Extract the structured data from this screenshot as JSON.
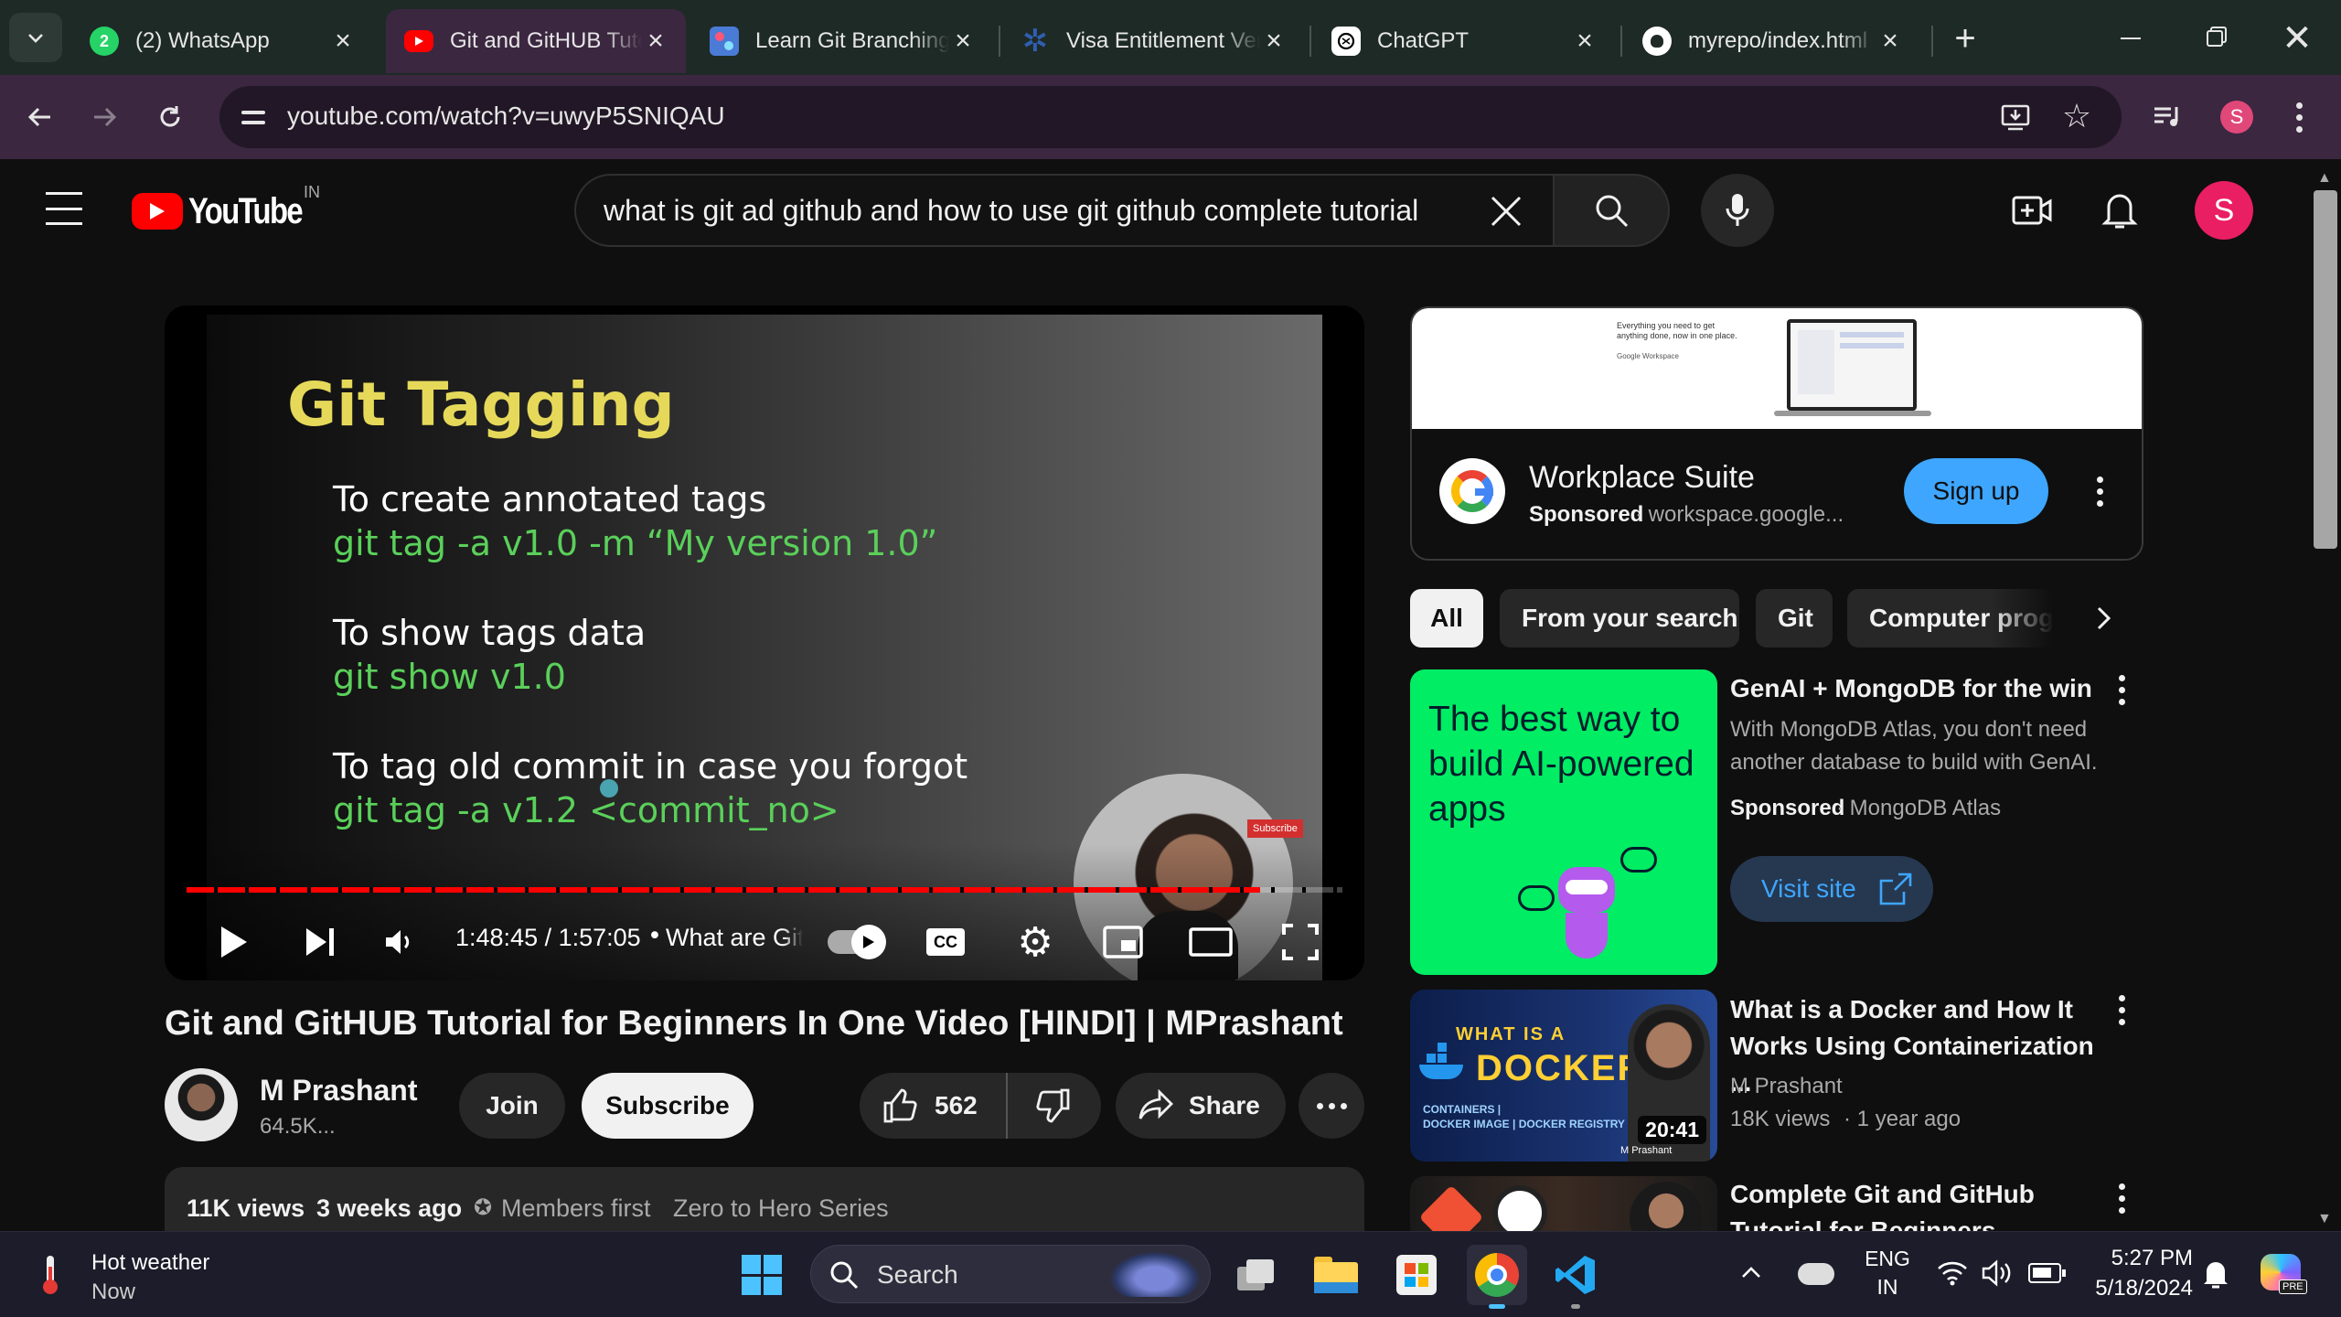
{
  "browser": {
    "tabs": [
      {
        "label": "(2) WhatsApp",
        "badge": "2"
      },
      {
        "label": "Git and GitHUB Tutorial for Beginners",
        "active": true
      },
      {
        "label": "Learn Git Branching"
      },
      {
        "label": "Visa Entitlement Verification"
      },
      {
        "label": "ChatGPT"
      },
      {
        "label": "myrepo/index.html"
      }
    ],
    "url": "youtube.com/watch?v=uwyP5SNIQAU",
    "profile_initial": "S"
  },
  "youtube": {
    "logo_text": "YouTube",
    "country": "IN",
    "search_query": "what is git ad github and how to use git github complete tutorial",
    "avatar_initial": "S"
  },
  "slide": {
    "heading": "Git Tagging",
    "items": [
      {
        "label": "To create annotated tags",
        "command": "git tag -a v1.0 -m “My version 1.0”"
      },
      {
        "label": "To show tags data",
        "command": "git show v1.0"
      },
      {
        "label": "To tag old commit in case you forgot",
        "command": "git tag -a v1.2 <commit_no>"
      }
    ],
    "subscribe_badge": "Subscribe"
  },
  "player": {
    "time": "1:48:45 / 1:57:05",
    "chapter": "What are Git Tags",
    "progress": 0.9288,
    "cc": "CC"
  },
  "video": {
    "title": "Git and GitHUB Tutorial for Beginners In One Video [HINDI] | MPrashant",
    "channel": "M Prashant",
    "subscribers": "64.5K...",
    "join": "Join",
    "subscribe": "Subscribe",
    "likes": "562",
    "share": "Share",
    "views": "11K views",
    "ago": "3 weeks ago",
    "members": "Members first",
    "series": "Zero to Hero Series"
  },
  "ad": {
    "banner_line1": "Everything you need to get",
    "banner_line2": "anything done, now in one place.",
    "banner_brand": "Google Workspace",
    "title": "Workplace Suite",
    "sponsored": "Sponsored",
    "domain": "workspace.google...",
    "cta": "Sign up"
  },
  "chips": [
    "All",
    "From your search",
    "Git",
    "Computer programming"
  ],
  "recommendations": [
    {
      "thumb_text": "The best way to build AI-powered apps",
      "title": "GenAI + MongoDB for the win",
      "description": "With MongoDB Atlas, you don't need another database to build with GenAI.",
      "sponsored": "Sponsored",
      "advertiser": "MongoDB Atlas",
      "cta": "Visit site"
    },
    {
      "thumb_line1": "WHAT IS A",
      "thumb_line2": "DOCKER?",
      "thumb_sub1": "CONTAINERS |",
      "thumb_sub2": "DOCKER IMAGE | DOCKER REGISTRY",
      "thumb_credit": "M Prashant",
      "duration": "20:41",
      "title": "What is a Docker and How It Works Using Containerization ...",
      "channel": "M Prashant",
      "views": "18K views",
      "ago": "1 year ago"
    },
    {
      "title": "Complete Git and GitHub Tutorial for Beginners"
    }
  ],
  "taskbar": {
    "weather_title": "Hot weather",
    "weather_sub": "Now",
    "search_placeholder": "Search",
    "lang1": "ENG",
    "lang2": "IN",
    "time": "5:27 PM",
    "date": "5/18/2024",
    "copilot_badge": "PRE"
  },
  "colors": {
    "tabstrip": "#1e2a26",
    "active_tab": "#3b2740",
    "yt_red": "#ff0000",
    "slide_heading": "#e6d95a",
    "slide_command": "#5ad05a",
    "mongo_green": "#00ed64",
    "sign_up": "#3ea6ff"
  }
}
